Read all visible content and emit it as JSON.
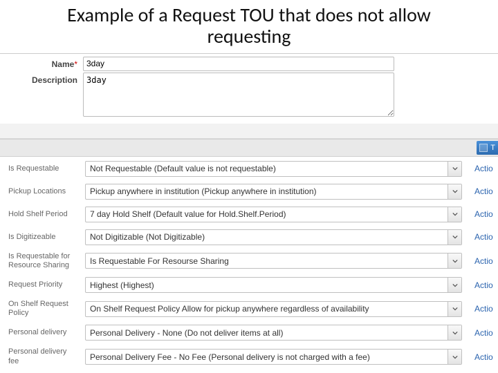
{
  "slide": {
    "title": "Example of a Request TOU that does not allow requesting"
  },
  "fields": {
    "name_label": "Name",
    "name_value": "3day",
    "description_label": "Description",
    "description_value": "3day"
  },
  "toolbar": {
    "button_label": "T"
  },
  "action_label": "Actio",
  "rules": [
    {
      "label": "Is Requestable",
      "value": "Not Requestable (Default value is not requestable)"
    },
    {
      "label": "Pickup Locations",
      "value": "Pickup anywhere in institution (Pickup anywhere in institution)"
    },
    {
      "label": "Hold Shelf Period",
      "value": "7 day Hold Shelf (Default value for Hold.Shelf.Period)"
    },
    {
      "label": "Is Digitizeable",
      "value": "Not Digitizable (Not Digitizable)"
    },
    {
      "label": "Is Requestable for Resource Sharing",
      "value": "Is Requestable For Resourse Sharing"
    },
    {
      "label": "Request Priority",
      "value": "Highest (Highest)"
    },
    {
      "label": "On Shelf Request Policy",
      "value": "On Shelf Request Policy Allow for pickup anywhere regardless of availability"
    },
    {
      "label": "Personal delivery",
      "value": "Personal Delivery - None (Do not deliver items at all)"
    },
    {
      "label": "Personal delivery fee",
      "value": "Personal Delivery Fee - No Fee (Personal delivery is not charged with a fee)"
    }
  ]
}
